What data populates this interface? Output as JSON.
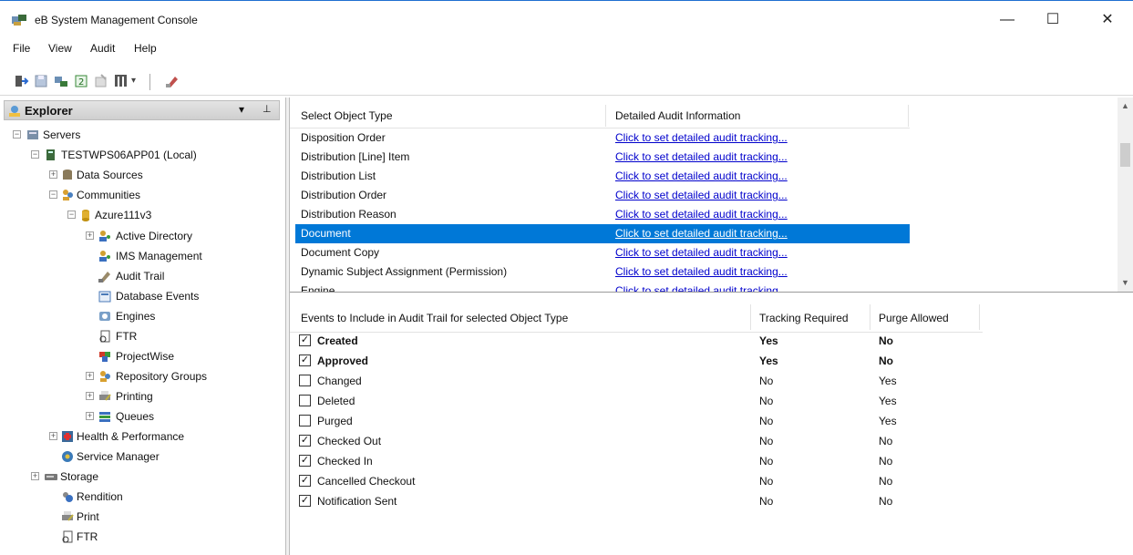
{
  "window": {
    "title": "eB System Management Console",
    "minimize": "—",
    "maximize": "☐",
    "close": "✕"
  },
  "menu": [
    "File",
    "View",
    "Audit",
    "Help"
  ],
  "explorer": {
    "title": "Explorer",
    "dropdown": "▾",
    "pin": "⊥"
  },
  "tree": [
    {
      "label": "Servers"
    },
    {
      "label": "TESTWPS06APP01 (Local)"
    },
    {
      "label": "Data Sources"
    },
    {
      "label": "Communities"
    },
    {
      "label": "Azure111v3"
    },
    {
      "label": "Active Directory"
    },
    {
      "label": "IMS Management"
    },
    {
      "label": "Audit Trail"
    },
    {
      "label": "Database Events"
    },
    {
      "label": "Engines"
    },
    {
      "label": "FTR"
    },
    {
      "label": "ProjectWise"
    },
    {
      "label": "Repository Groups"
    },
    {
      "label": "Printing"
    },
    {
      "label": "Queues"
    },
    {
      "label": "Health & Performance"
    },
    {
      "label": "Service Manager"
    },
    {
      "label": "Storage"
    },
    {
      "label": "Rendition"
    },
    {
      "label": "Print"
    },
    {
      "label": "FTR"
    }
  ],
  "upper": {
    "headers": [
      "Select Object Type",
      "Detailed Audit Information"
    ],
    "link_text": "Click to set detailed audit tracking...",
    "rows": [
      "Disposition Order",
      "Distribution [Line] Item",
      "Distribution List",
      "Distribution Order",
      "Distribution Reason",
      "Document",
      "Document Copy",
      "Dynamic Subject Assignment (Permission)",
      "Engine"
    ],
    "selected_index": 5
  },
  "lower": {
    "headers": [
      "Events to Include in Audit Trail for selected Object Type",
      "Tracking Required",
      "Purge Allowed"
    ],
    "rows": [
      {
        "event": "Created",
        "tracking": "Yes",
        "purge": "No",
        "checked": true,
        "bold": true
      },
      {
        "event": "Approved",
        "tracking": "Yes",
        "purge": "No",
        "checked": true,
        "bold": true
      },
      {
        "event": "Changed",
        "tracking": "No",
        "purge": "Yes",
        "checked": false,
        "bold": false
      },
      {
        "event": "Deleted",
        "tracking": "No",
        "purge": "Yes",
        "checked": false,
        "bold": false
      },
      {
        "event": "Purged",
        "tracking": "No",
        "purge": "Yes",
        "checked": false,
        "bold": false
      },
      {
        "event": "Checked Out",
        "tracking": "No",
        "purge": "No",
        "checked": true,
        "bold": false
      },
      {
        "event": "Checked In",
        "tracking": "No",
        "purge": "No",
        "checked": true,
        "bold": false
      },
      {
        "event": "Cancelled Checkout",
        "tracking": "No",
        "purge": "No",
        "checked": true,
        "bold": false
      },
      {
        "event": "Notification Sent",
        "tracking": "No",
        "purge": "No",
        "checked": true,
        "bold": false
      }
    ]
  },
  "colors": {
    "selection": "#0078d7",
    "link": "#0000cc"
  }
}
